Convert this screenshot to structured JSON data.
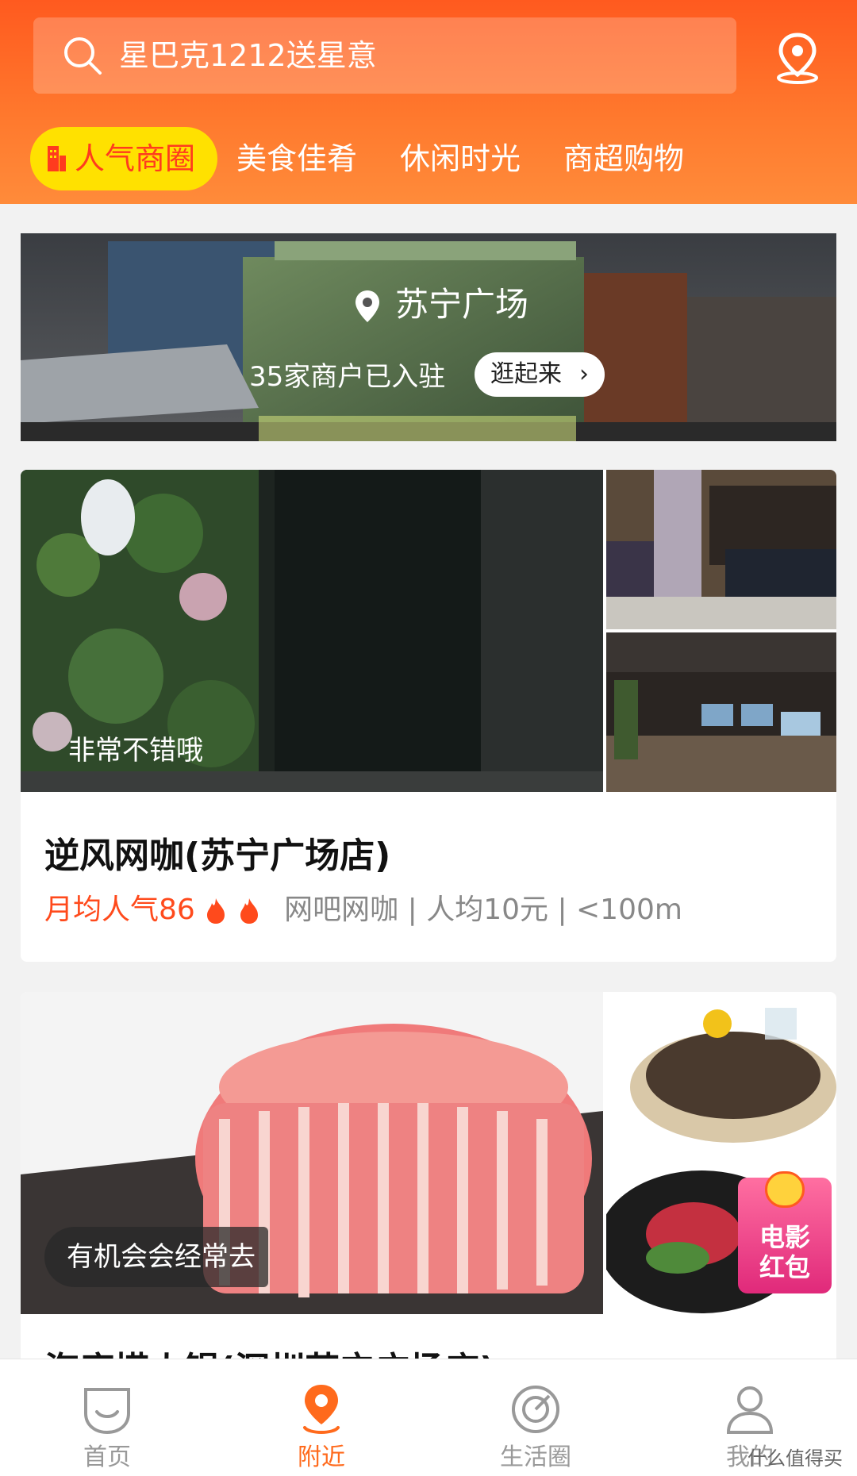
{
  "search": {
    "text": "星巴克1212送星意"
  },
  "tabs": [
    {
      "label": "人气商圈"
    },
    {
      "label": "美食佳肴"
    },
    {
      "label": "休闲时光"
    },
    {
      "label": "商超购物"
    }
  ],
  "banner": {
    "title": "苏宁广场",
    "subtitle": "35家商户已入驻",
    "button": "逛起来"
  },
  "card1": {
    "comment": "非常不错哦",
    "name": "逆风网咖(苏宁广场店)",
    "popularity": "月均人气86",
    "info": "网吧网咖 | 人均10元 | <100m"
  },
  "card2": {
    "comment": "有机会会经常去",
    "name": "海底捞火锅(深圳苏宁广场店)"
  },
  "floating": {
    "line1": "电影",
    "line2": "红包"
  },
  "nav": [
    {
      "label": "首页"
    },
    {
      "label": "附近"
    },
    {
      "label": "生活圈"
    },
    {
      "label": "我的"
    }
  ],
  "watermark": "什么值得买",
  "colors": {
    "accent": "#ff6a1c",
    "active_tab_bg": "#ffe100",
    "popularity": "#ff4a1c"
  }
}
